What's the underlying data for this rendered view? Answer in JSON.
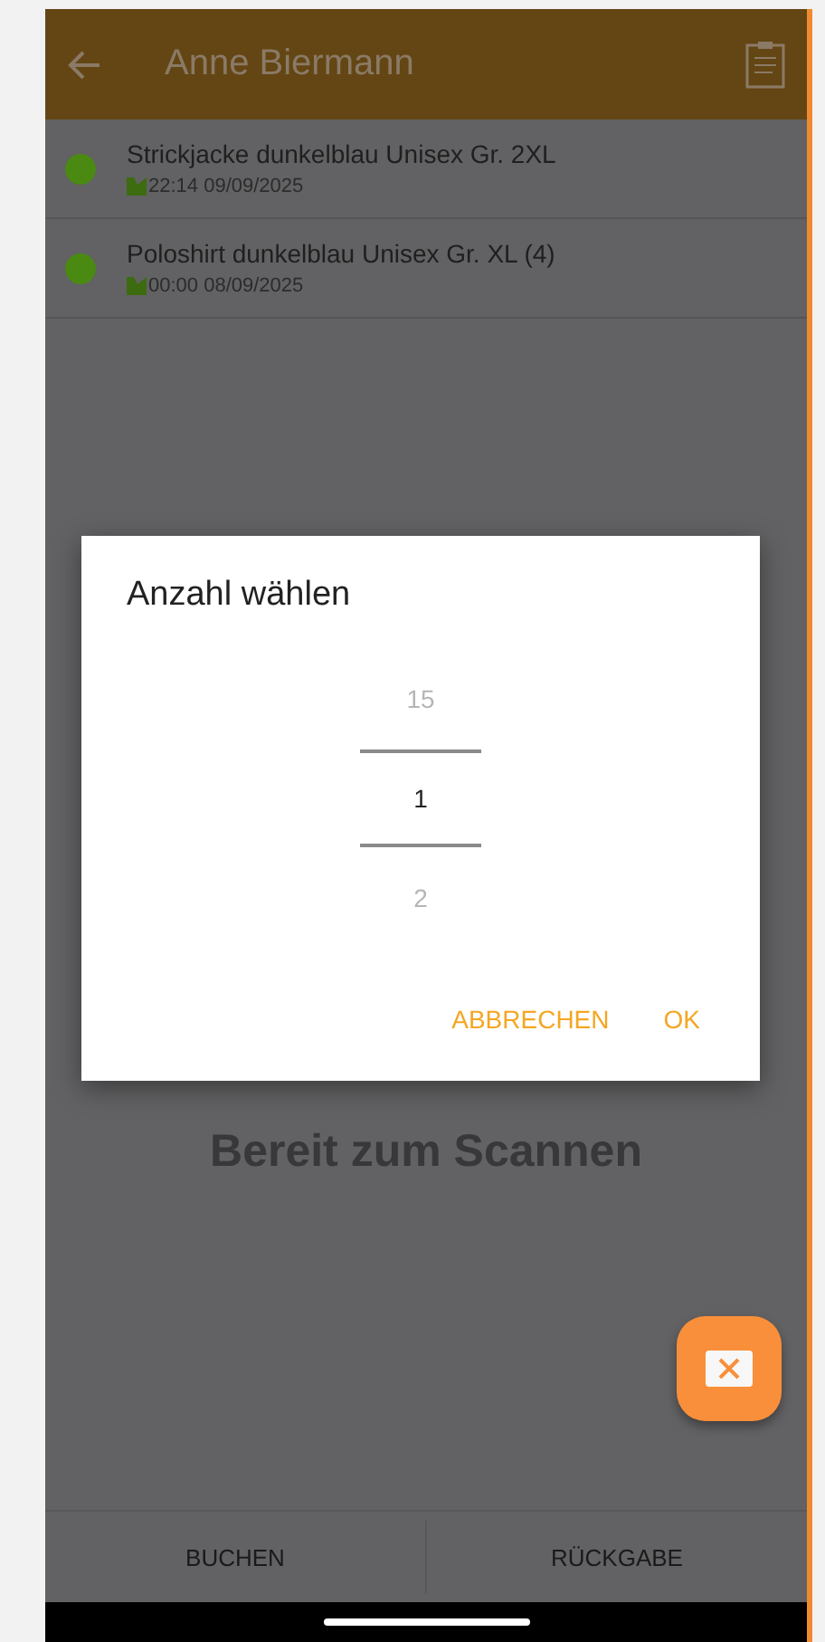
{
  "app_bar": {
    "title": "Anne Biermann"
  },
  "items": [
    {
      "name": "Strickjacke dunkelblau Unisex Gr. 2XL",
      "time": "22:14 09/09/2025",
      "color": "#4a8a12"
    },
    {
      "name": "Poloshirt dunkelblau Unisex Gr. XL (4)",
      "time": "00:00 08/09/2025",
      "color": "#4a8a12"
    }
  ],
  "status": "Bereit zum Scannen",
  "dialog": {
    "title": "Anzahl wählen",
    "picker": [
      {
        "value": "15",
        "selected": false
      },
      {
        "value": "1",
        "selected": true
      },
      {
        "value": "2",
        "selected": false
      }
    ],
    "buttons": [
      "ABBRECHEN",
      "OK"
    ]
  },
  "bottom_tabs": [
    "BUCHEN",
    "RÜCKGABE"
  ]
}
